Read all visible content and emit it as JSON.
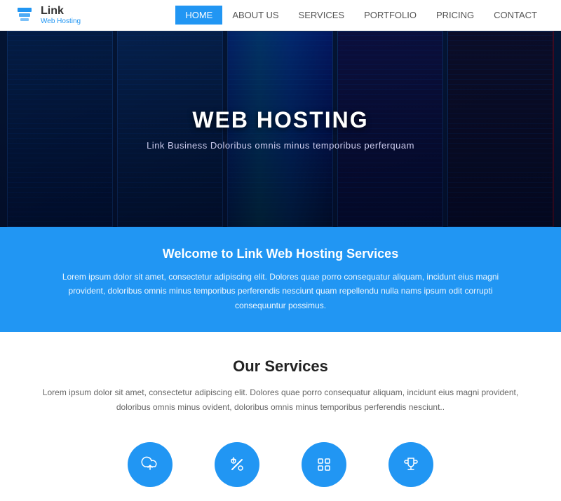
{
  "navbar": {
    "logo_link": "Link",
    "logo_sub": "Web Hosting",
    "nav_items": [
      {
        "label": "HOME",
        "active": true
      },
      {
        "label": "ABOUT US",
        "active": false
      },
      {
        "label": "SERVICES",
        "active": false
      },
      {
        "label": "PORTFOLIO",
        "active": false
      },
      {
        "label": "PRICING",
        "active": false
      },
      {
        "label": "CONTACT",
        "active": false
      }
    ]
  },
  "hero": {
    "title": "WEB HOSTING",
    "subtitle": "Link Business Doloribus omnis minus temporibus perferquam"
  },
  "welcome": {
    "title": "Welcome to Link Web Hosting Services",
    "text": "Lorem ipsum dolor sit amet, consectetur adipiscing elit. Dolores quae porro consequatur aliquam, incidunt eius magni provident, doloribus omnis minus temporibus perferendis nesciunt quam repellendu nulla nams ipsum odit corrupti consequuntur possimus."
  },
  "services": {
    "title": "Our Services",
    "text": "Lorem ipsum dolor sit amet, consectetur adipiscing elit. Dolores quae porro consequatur aliquam, incidunt eius magni provident, doloribus omnis minus ovident, doloribus omnis minus temporibus perferendis nesciunt..",
    "icons": [
      {
        "name": "cloud-upload",
        "symbol": "☁"
      },
      {
        "name": "tools",
        "symbol": "✂"
      },
      {
        "name": "grid",
        "symbol": "⊞"
      },
      {
        "name": "trophy",
        "symbol": "🏆"
      }
    ]
  }
}
